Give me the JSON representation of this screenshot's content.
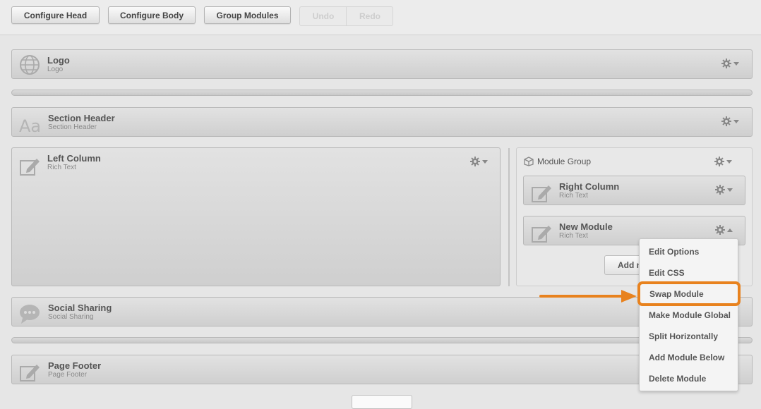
{
  "toolbar": {
    "configure_head": "Configure Head",
    "configure_body": "Configure Body",
    "group_modules": "Group Modules",
    "undo": "Undo",
    "redo": "Redo"
  },
  "modules": {
    "logo": {
      "title": "Logo",
      "type": "Logo"
    },
    "section_header": {
      "title": "Section Header",
      "type": "Section Header",
      "icon_text": "Aa"
    },
    "left_column": {
      "title": "Left Column",
      "type": "Rich Text"
    },
    "social_sharing": {
      "title": "Social Sharing",
      "type": "Social Sharing"
    },
    "page_footer": {
      "title": "Page Footer",
      "type": "Page Footer"
    }
  },
  "module_group": {
    "label": "Module Group",
    "right_column": {
      "title": "Right Column",
      "type": "Rich Text"
    },
    "new_module": {
      "title": "New Module",
      "type": "Rich Text"
    },
    "add_button": "Add m"
  },
  "context_menu": {
    "items": [
      "Edit Options",
      "Edit CSS",
      "Swap Module",
      "Make Module Global",
      "Split Horizontally",
      "Add Module Below",
      "Delete Module"
    ],
    "highlighted": "Swap Module"
  },
  "colors": {
    "highlight": "#e8821e",
    "arrow": "#e8821e"
  },
  "icons": [
    "globe-icon",
    "text-icon",
    "edit-icon",
    "speech-bubble-icon",
    "gear-icon",
    "caret-down-icon",
    "caret-up-icon",
    "cube-icon",
    "arrow-icon"
  ]
}
